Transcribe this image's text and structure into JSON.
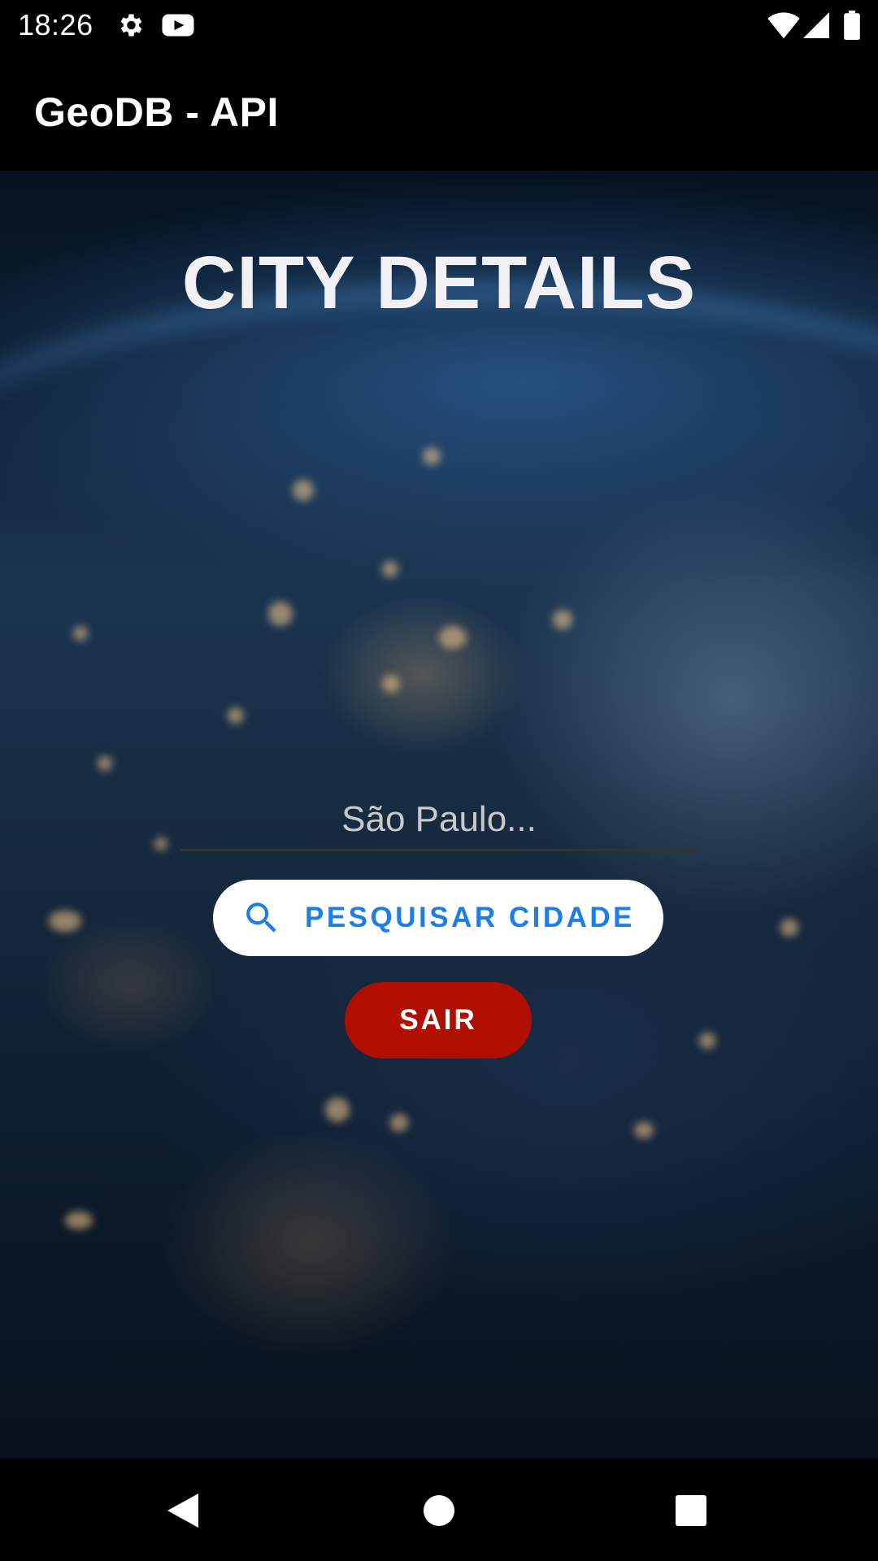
{
  "status_bar": {
    "time": "18:26",
    "icons": [
      "gear-icon",
      "youtube-icon",
      "wifi-icon",
      "signal-icon",
      "battery-icon"
    ]
  },
  "app_bar": {
    "title": "GeoDB - API"
  },
  "main": {
    "title": "CITY DETAILS",
    "city_input": {
      "value": "",
      "placeholder": "São Paulo..."
    },
    "search_button": {
      "icon": "search-icon",
      "label": "PESQUISAR CIDADE"
    },
    "exit_button": {
      "label": "SAIR"
    }
  },
  "nav_bar": {
    "buttons": [
      "back-icon",
      "home-icon",
      "recents-icon"
    ]
  },
  "colors": {
    "search_accent": "#1f7de6",
    "exit_button_bg": "#b00f00",
    "bars_bg": "#000000"
  }
}
